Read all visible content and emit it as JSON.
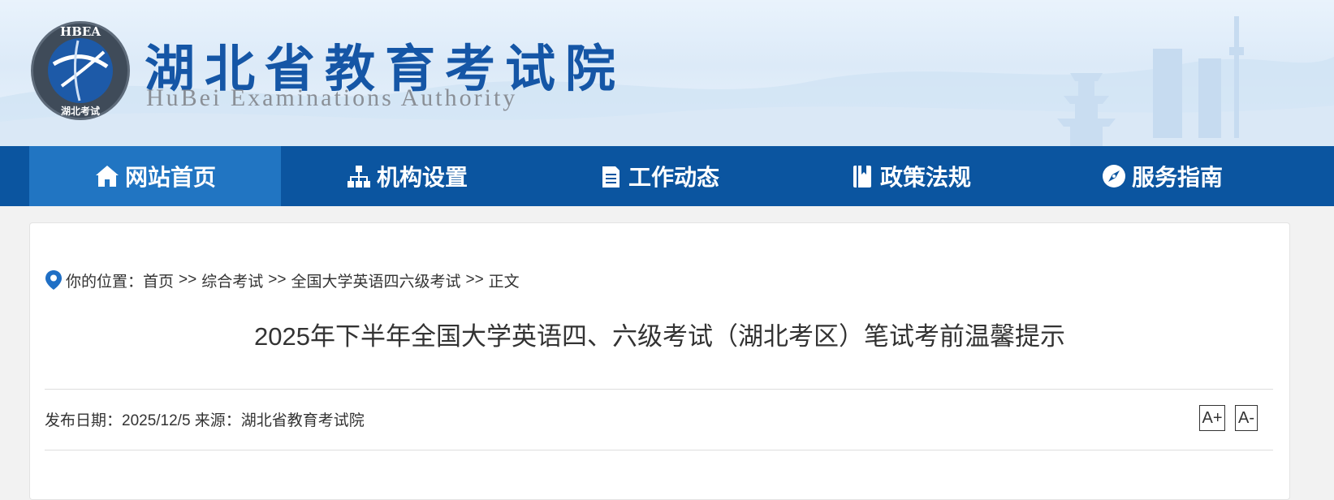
{
  "header": {
    "title": "湖北省教育考试院",
    "subtitle": "HuBei Examinations Authority",
    "logo_text_top": "HBEA",
    "logo_text_bottom": "湖北考试"
  },
  "nav": {
    "items": [
      {
        "label": "网站首页",
        "icon": "home-icon",
        "active": true
      },
      {
        "label": "机构设置",
        "icon": "org-chart-icon",
        "active": false
      },
      {
        "label": "工作动态",
        "icon": "document-icon",
        "active": false
      },
      {
        "label": "政策法规",
        "icon": "book-icon",
        "active": false
      },
      {
        "label": "服务指南",
        "icon": "compass-icon",
        "active": false
      }
    ]
  },
  "breadcrumb": {
    "prefix": "你的位置：",
    "items": [
      "首页",
      "综合考试",
      "全国大学英语四六级考试",
      "正文"
    ],
    "separator": ">>"
  },
  "article": {
    "title": "2025年下半年全国大学英语四、六级考试（湖北考区）笔试考前温馨提示",
    "meta": "发布日期：2025/12/5 来源：湖北省教育考试院",
    "font_increase": "A+",
    "font_decrease": "A-"
  },
  "colors": {
    "nav_bg": "#0b55a0",
    "nav_active": "#2175c2",
    "title_blue": "#1556a6"
  }
}
